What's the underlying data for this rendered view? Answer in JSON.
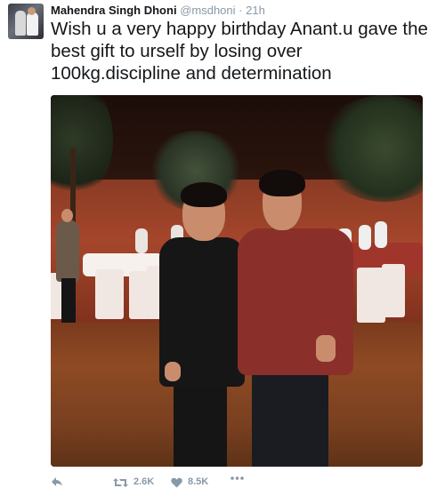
{
  "tweet": {
    "author_name": "Mahendra Singh Dhoni",
    "author_handle": "@msdhoni",
    "separator": "·",
    "time": "21h",
    "text": "Wish u a very happy birthday Anant.u gave the best gift to urself by losing over 100kg.discipline and determination",
    "avatar_icon": "profile-photo-icon"
  },
  "actions": {
    "reply_icon": "reply-icon",
    "retweet_icon": "retweet-icon",
    "retweet_count": "2.6K",
    "like_icon": "heart-icon",
    "like_count": "8.5K",
    "more_icon": "more-dots-icon"
  },
  "colors": {
    "text": "#14171a",
    "muted": "#8899a6",
    "photo_red": "#8b2f2a"
  }
}
